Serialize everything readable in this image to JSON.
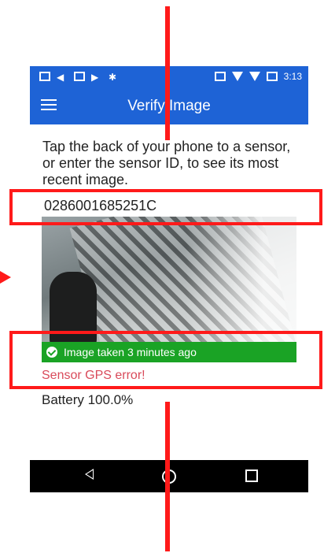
{
  "status_bar": {
    "time": "3:13"
  },
  "app_bar": {
    "title": "Verify Image",
    "menu_icon": "hamburger-menu-icon"
  },
  "content": {
    "instructions": "Tap the back of your phone to a sensor, or enter the sensor ID, to see its most recent image.",
    "sensor_id": "0286001685251C",
    "image_status": "Image taken 3 minutes ago",
    "gps_error": "Sensor GPS error!",
    "battery": "Battery 100.0%"
  },
  "nav_bar": {
    "back_icon": "back-icon",
    "home_icon": "home-icon",
    "recent_icon": "recent-apps-icon"
  },
  "colors": {
    "primary": "#1e63d6",
    "success": "#1aa325",
    "error": "#d94a5a",
    "annotation": "#ff1a1a"
  }
}
